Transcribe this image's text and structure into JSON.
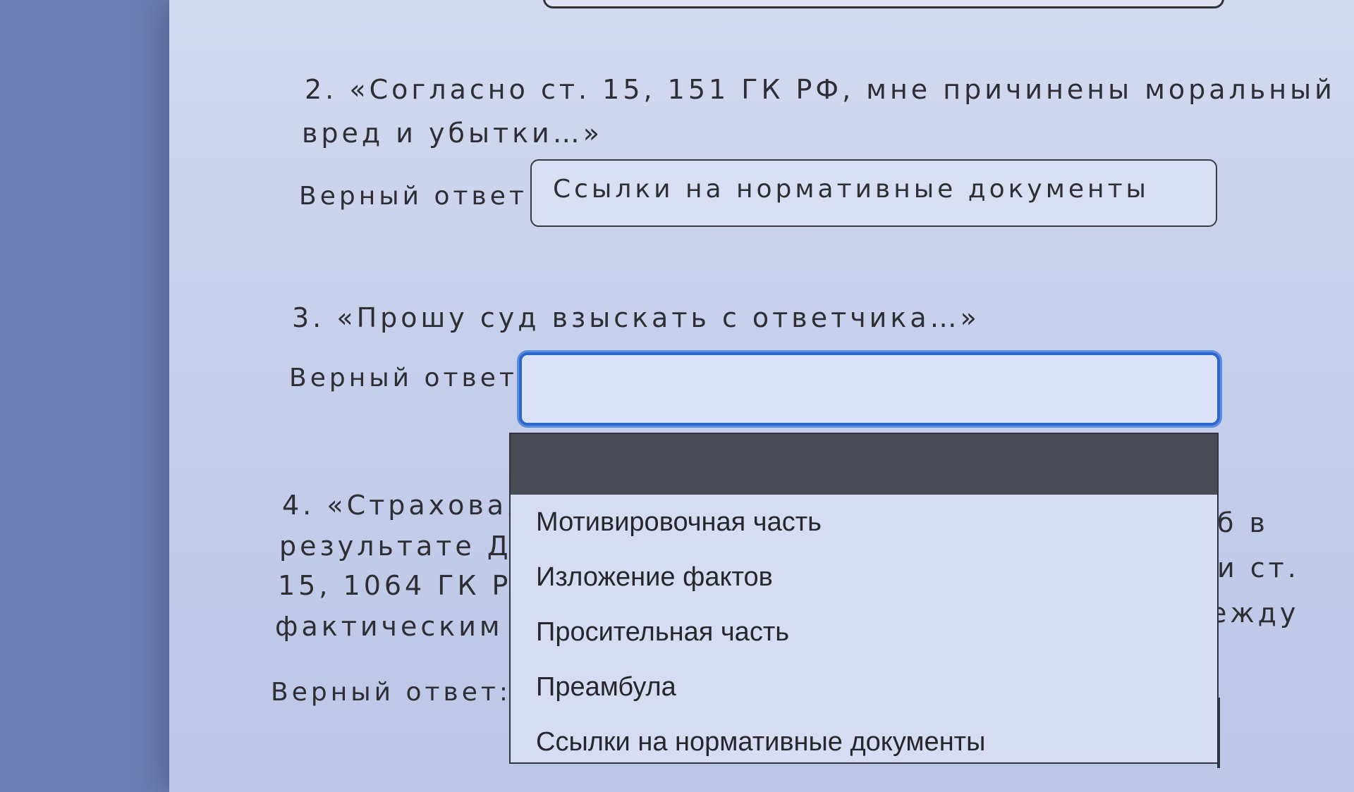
{
  "q2": {
    "line1": "2. «Согласно ст. 15, 151 ГК РФ, мне причинены моральный",
    "line2": "вред и убытки…»",
    "answer_label": "Верный ответ:",
    "answer_value": "Ссылки на нормативные документы"
  },
  "q3": {
    "text": "3. «Прошу суд взыскать с ответчика…»",
    "answer_label": "Верный ответ:",
    "answer_value": ""
  },
  "q4": {
    "line1": "4. «Страховая в",
    "line2": "результате ДТП",
    "line3": "15, 1064 ГК РФ",
    "line4": "фактическим у",
    "tail1": "б в",
    "tail2": "и ст.",
    "tail3": "ежду",
    "answer_label": "Верный ответ:"
  },
  "dropdown": {
    "items": [
      "Мотивировочная часть",
      "Изложение фактов",
      "Просительная часть",
      "Преамбула",
      "Ссылки на нормативные документы"
    ]
  }
}
